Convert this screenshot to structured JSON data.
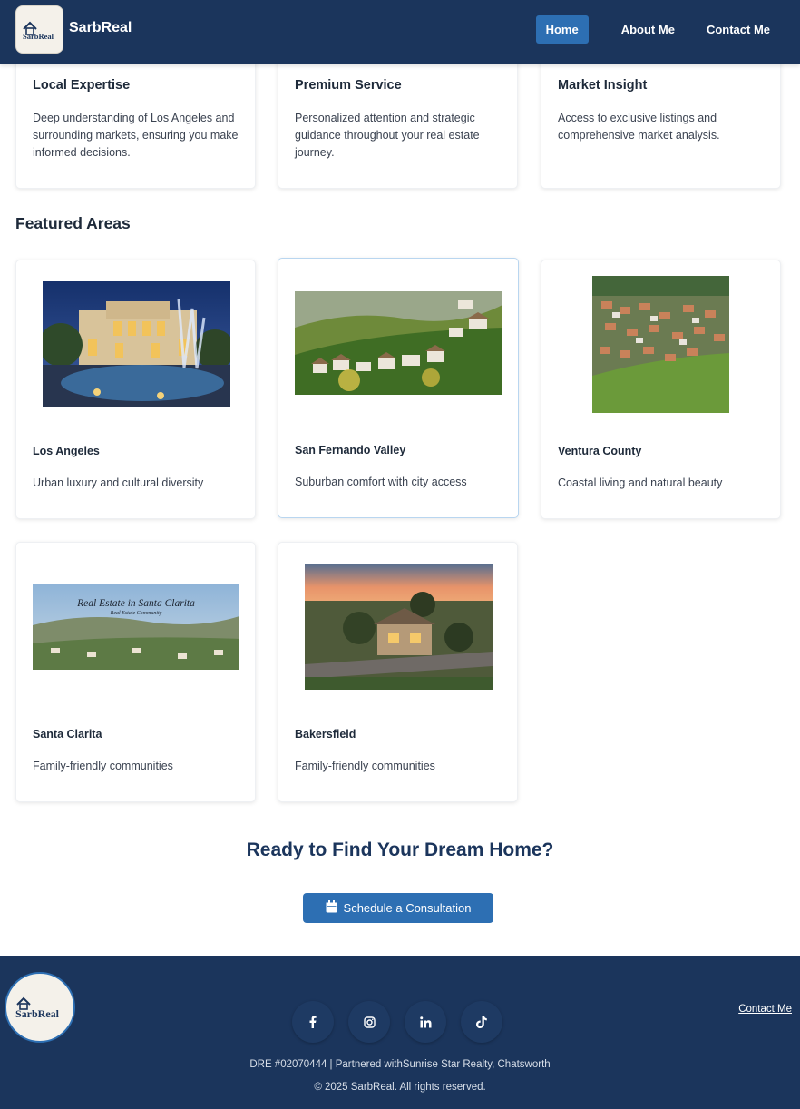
{
  "header": {
    "brand": "SarbReal",
    "logo_text": "SarbReal",
    "nav": [
      {
        "label": "Home",
        "active": true
      },
      {
        "label": "About Me",
        "active": false
      },
      {
        "label": "Contact Me",
        "active": false
      }
    ]
  },
  "features": [
    {
      "title": "Local Expertise",
      "text": "Deep understanding of Los Angeles and surrounding markets, ensuring you make informed decisions."
    },
    {
      "title": "Premium Service",
      "text": "Personalized attention and strategic guidance throughout your real estate journey."
    },
    {
      "title": "Market Insight",
      "text": "Access to exclusive listings and comprehensive market analysis."
    }
  ],
  "featured_areas": {
    "title": "Featured Areas",
    "areas": [
      {
        "name": "Los Angeles",
        "description": "Urban luxury and cultural diversity"
      },
      {
        "name": "San Fernando Valley",
        "description": "Suburban comfort with city access"
      },
      {
        "name": "Ventura County",
        "description": "Coastal living and natural beauty"
      },
      {
        "name": "Santa Clarita",
        "description": "Family-friendly communities",
        "image_caption": "Real Estate in Santa Clarita",
        "image_subcaption": "Real Estate Community"
      },
      {
        "name": "Bakersfield",
        "description": "Family-friendly communities"
      }
    ]
  },
  "cta": {
    "title": "Ready to Find Your Dream Home?",
    "button_label": "Schedule a Consultation",
    "button_icon": "calendar-icon"
  },
  "footer": {
    "logo_text": "SarbReal",
    "contact_link": "Contact Me",
    "socials": [
      "facebook-icon",
      "instagram-icon",
      "linkedin-icon",
      "tiktok-icon"
    ],
    "license_line": "DRE #02070444 | Partnered withSunrise Star Realty, Chatsworth",
    "copyright": "© 2025 SarbReal. All rights reserved."
  },
  "colors": {
    "navy": "#1b355c",
    "accent_blue": "#2d6fb3",
    "card_highlight_border": "#b9d6f0"
  }
}
